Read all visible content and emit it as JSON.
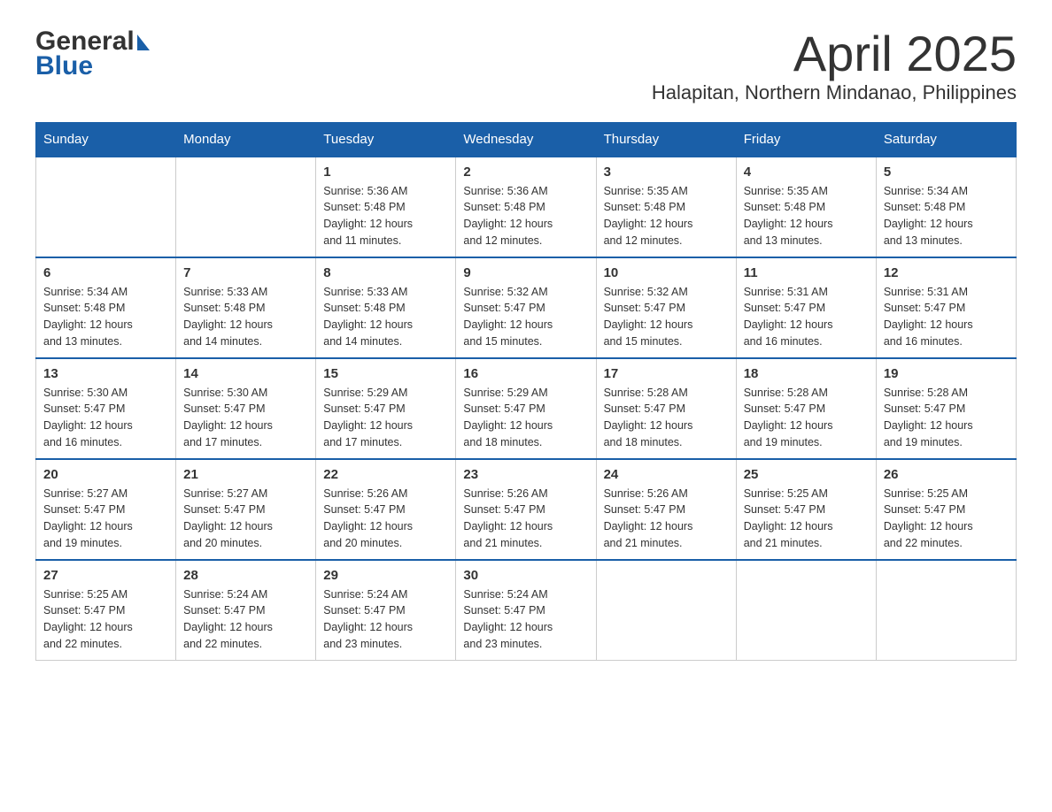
{
  "logo": {
    "general": "General",
    "blue": "Blue"
  },
  "title": {
    "month_year": "April 2025",
    "location": "Halapitan, Northern Mindanao, Philippines"
  },
  "header": {
    "days": [
      "Sunday",
      "Monday",
      "Tuesday",
      "Wednesday",
      "Thursday",
      "Friday",
      "Saturday"
    ]
  },
  "weeks": [
    {
      "cells": [
        {
          "day": "",
          "info": ""
        },
        {
          "day": "",
          "info": ""
        },
        {
          "day": "1",
          "info": "Sunrise: 5:36 AM\nSunset: 5:48 PM\nDaylight: 12 hours\nand 11 minutes."
        },
        {
          "day": "2",
          "info": "Sunrise: 5:36 AM\nSunset: 5:48 PM\nDaylight: 12 hours\nand 12 minutes."
        },
        {
          "day": "3",
          "info": "Sunrise: 5:35 AM\nSunset: 5:48 PM\nDaylight: 12 hours\nand 12 minutes."
        },
        {
          "day": "4",
          "info": "Sunrise: 5:35 AM\nSunset: 5:48 PM\nDaylight: 12 hours\nand 13 minutes."
        },
        {
          "day": "5",
          "info": "Sunrise: 5:34 AM\nSunset: 5:48 PM\nDaylight: 12 hours\nand 13 minutes."
        }
      ]
    },
    {
      "cells": [
        {
          "day": "6",
          "info": "Sunrise: 5:34 AM\nSunset: 5:48 PM\nDaylight: 12 hours\nand 13 minutes."
        },
        {
          "day": "7",
          "info": "Sunrise: 5:33 AM\nSunset: 5:48 PM\nDaylight: 12 hours\nand 14 minutes."
        },
        {
          "day": "8",
          "info": "Sunrise: 5:33 AM\nSunset: 5:48 PM\nDaylight: 12 hours\nand 14 minutes."
        },
        {
          "day": "9",
          "info": "Sunrise: 5:32 AM\nSunset: 5:47 PM\nDaylight: 12 hours\nand 15 minutes."
        },
        {
          "day": "10",
          "info": "Sunrise: 5:32 AM\nSunset: 5:47 PM\nDaylight: 12 hours\nand 15 minutes."
        },
        {
          "day": "11",
          "info": "Sunrise: 5:31 AM\nSunset: 5:47 PM\nDaylight: 12 hours\nand 16 minutes."
        },
        {
          "day": "12",
          "info": "Sunrise: 5:31 AM\nSunset: 5:47 PM\nDaylight: 12 hours\nand 16 minutes."
        }
      ]
    },
    {
      "cells": [
        {
          "day": "13",
          "info": "Sunrise: 5:30 AM\nSunset: 5:47 PM\nDaylight: 12 hours\nand 16 minutes."
        },
        {
          "day": "14",
          "info": "Sunrise: 5:30 AM\nSunset: 5:47 PM\nDaylight: 12 hours\nand 17 minutes."
        },
        {
          "day": "15",
          "info": "Sunrise: 5:29 AM\nSunset: 5:47 PM\nDaylight: 12 hours\nand 17 minutes."
        },
        {
          "day": "16",
          "info": "Sunrise: 5:29 AM\nSunset: 5:47 PM\nDaylight: 12 hours\nand 18 minutes."
        },
        {
          "day": "17",
          "info": "Sunrise: 5:28 AM\nSunset: 5:47 PM\nDaylight: 12 hours\nand 18 minutes."
        },
        {
          "day": "18",
          "info": "Sunrise: 5:28 AM\nSunset: 5:47 PM\nDaylight: 12 hours\nand 19 minutes."
        },
        {
          "day": "19",
          "info": "Sunrise: 5:28 AM\nSunset: 5:47 PM\nDaylight: 12 hours\nand 19 minutes."
        }
      ]
    },
    {
      "cells": [
        {
          "day": "20",
          "info": "Sunrise: 5:27 AM\nSunset: 5:47 PM\nDaylight: 12 hours\nand 19 minutes."
        },
        {
          "day": "21",
          "info": "Sunrise: 5:27 AM\nSunset: 5:47 PM\nDaylight: 12 hours\nand 20 minutes."
        },
        {
          "day": "22",
          "info": "Sunrise: 5:26 AM\nSunset: 5:47 PM\nDaylight: 12 hours\nand 20 minutes."
        },
        {
          "day": "23",
          "info": "Sunrise: 5:26 AM\nSunset: 5:47 PM\nDaylight: 12 hours\nand 21 minutes."
        },
        {
          "day": "24",
          "info": "Sunrise: 5:26 AM\nSunset: 5:47 PM\nDaylight: 12 hours\nand 21 minutes."
        },
        {
          "day": "25",
          "info": "Sunrise: 5:25 AM\nSunset: 5:47 PM\nDaylight: 12 hours\nand 21 minutes."
        },
        {
          "day": "26",
          "info": "Sunrise: 5:25 AM\nSunset: 5:47 PM\nDaylight: 12 hours\nand 22 minutes."
        }
      ]
    },
    {
      "cells": [
        {
          "day": "27",
          "info": "Sunrise: 5:25 AM\nSunset: 5:47 PM\nDaylight: 12 hours\nand 22 minutes."
        },
        {
          "day": "28",
          "info": "Sunrise: 5:24 AM\nSunset: 5:47 PM\nDaylight: 12 hours\nand 22 minutes."
        },
        {
          "day": "29",
          "info": "Sunrise: 5:24 AM\nSunset: 5:47 PM\nDaylight: 12 hours\nand 23 minutes."
        },
        {
          "day": "30",
          "info": "Sunrise: 5:24 AM\nSunset: 5:47 PM\nDaylight: 12 hours\nand 23 minutes."
        },
        {
          "day": "",
          "info": ""
        },
        {
          "day": "",
          "info": ""
        },
        {
          "day": "",
          "info": ""
        }
      ]
    }
  ]
}
